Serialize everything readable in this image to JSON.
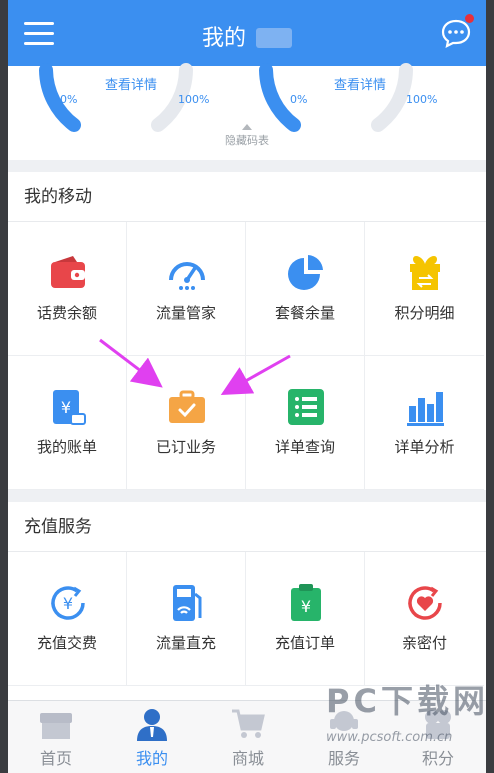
{
  "header": {
    "title": "我的",
    "colors": {
      "bar": "#3b8ff0"
    }
  },
  "gauges": [
    {
      "detail_label": "查看详情",
      "min_label": "0%",
      "max_label": "100%"
    },
    {
      "detail_label": "查看详情",
      "min_label": "0%",
      "max_label": "100%"
    }
  ],
  "hide_table_label": "隐藏码表",
  "my_mobile": {
    "title": "我的移动",
    "items": [
      {
        "label": "话费余额",
        "icon": "wallet-icon",
        "color": "#e8464a"
      },
      {
        "label": "流量管家",
        "icon": "speedometer-icon",
        "color": "#3b8ff0"
      },
      {
        "label": "套餐余量",
        "icon": "pie-chart-icon",
        "color": "#3b8ff0"
      },
      {
        "label": "积分明细",
        "icon": "gift-icon",
        "color": "#f5c400"
      },
      {
        "label": "我的账单",
        "icon": "bill-icon",
        "color": "#3b8ff0"
      },
      {
        "label": "已订业务",
        "icon": "briefcase-icon",
        "color": "#f5a545"
      },
      {
        "label": "详单查询",
        "icon": "list-icon",
        "color": "#27b46a"
      },
      {
        "label": "详单分析",
        "icon": "bar-chart-icon",
        "color": "#3b8ff0"
      }
    ]
  },
  "recharge": {
    "title": "充值服务",
    "items": [
      {
        "label": "充值交费",
        "icon": "yen-recharge-icon",
        "color": "#3b8ff0"
      },
      {
        "label": "流量直充",
        "icon": "data-recharge-icon",
        "color": "#3b8ff0"
      },
      {
        "label": "充值订单",
        "icon": "order-clipboard-icon",
        "color": "#27b46a"
      },
      {
        "label": "亲密付",
        "icon": "heart-pay-icon",
        "color": "#e8464a"
      }
    ]
  },
  "bottom_nav": [
    {
      "label": "首页",
      "icon": "home-icon",
      "active": false
    },
    {
      "label": "我的",
      "icon": "profile-icon",
      "active": true
    },
    {
      "label": "商城",
      "icon": "cart-icon",
      "active": false
    },
    {
      "label": "服务",
      "icon": "service-icon",
      "active": false
    },
    {
      "label": "积分",
      "icon": "points-icon",
      "active": false
    }
  ],
  "watermark": {
    "brand": "PC下载网",
    "url": "www.pcsoft.com.cn"
  },
  "annotation_color": "#e040f0"
}
